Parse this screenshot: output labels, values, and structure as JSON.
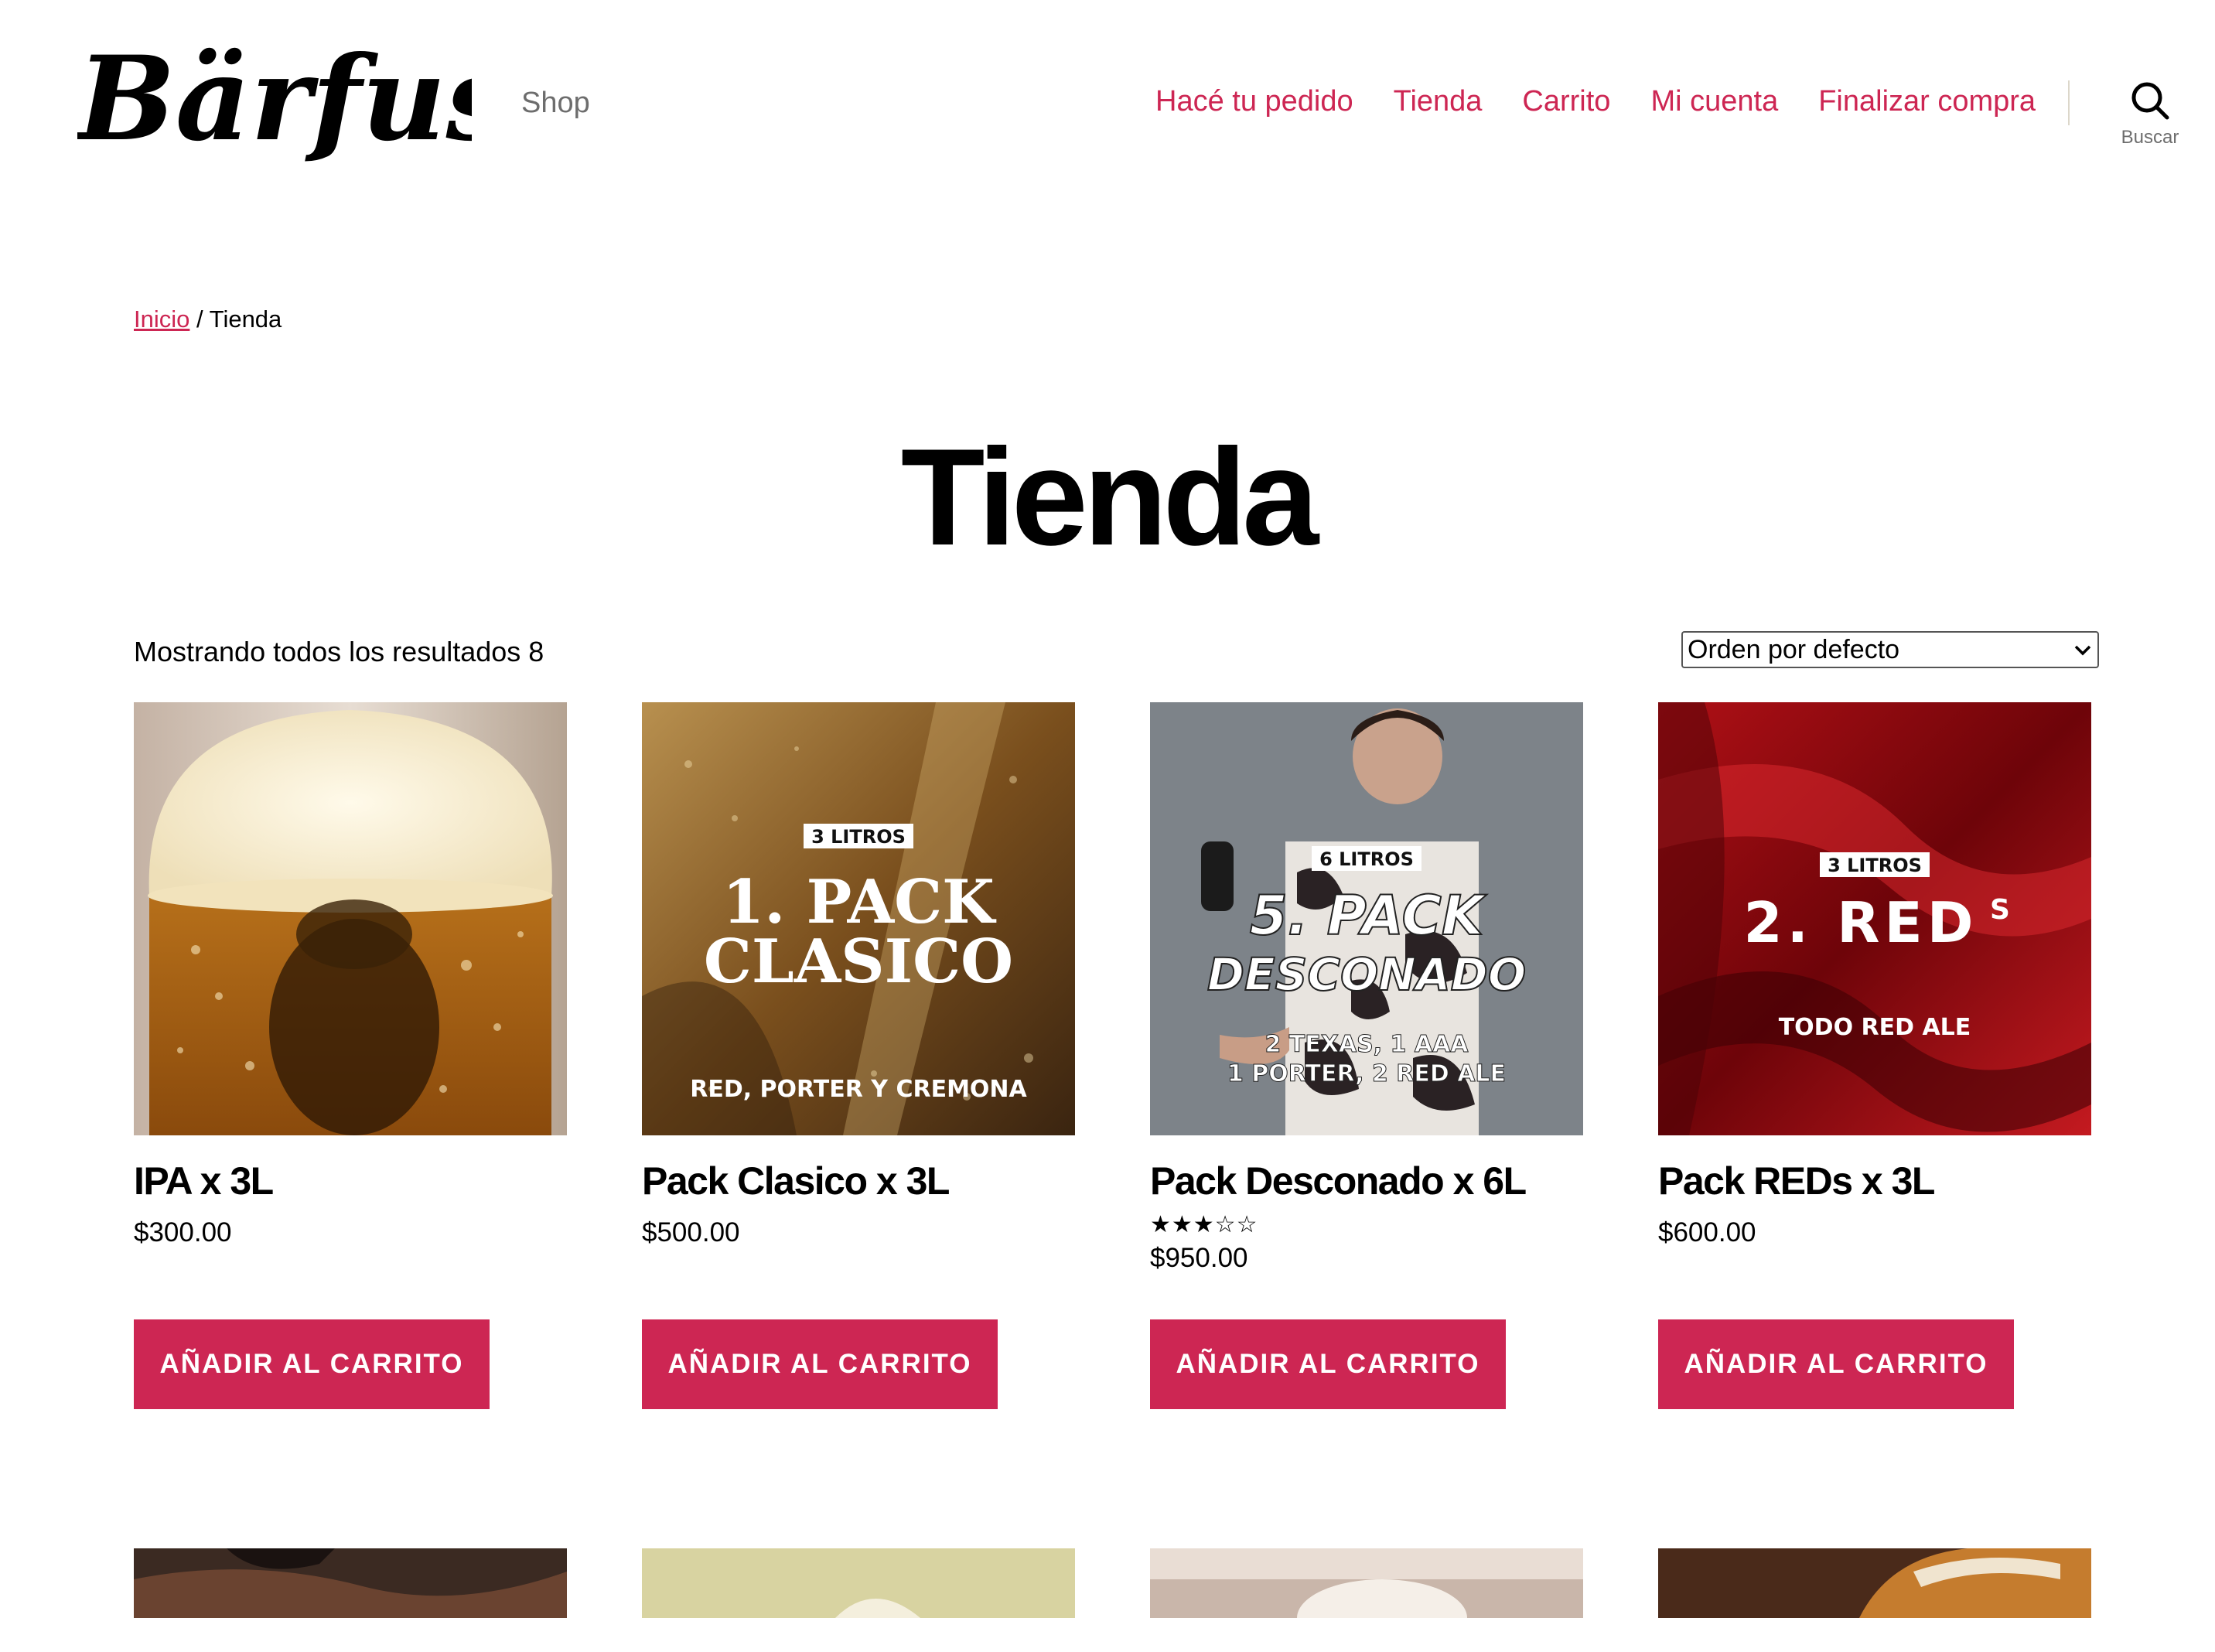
{
  "site": {
    "logo_text": "Bärfuss",
    "tagline": "Shop"
  },
  "nav": {
    "items": [
      {
        "label": "Hacé tu pedido"
      },
      {
        "label": "Tienda"
      },
      {
        "label": "Carrito"
      },
      {
        "label": "Mi cuenta"
      },
      {
        "label": "Finalizar compra"
      }
    ],
    "search_label": "Buscar"
  },
  "breadcrumb": {
    "home": "Inicio",
    "separator": " / ",
    "current": "Tienda"
  },
  "page": {
    "title": "Tienda",
    "result_count": "Mostrando todos los resultados 8",
    "ordering": "Orden por defecto"
  },
  "colors": {
    "accent": "#cd2653"
  },
  "products": [
    {
      "name": "IPA x 3L",
      "price": "$300.00",
      "button": "AÑADIR AL CARRITO"
    },
    {
      "name": "Pack Clasico x 3L",
      "price": "$500.00",
      "button": "AÑADIR AL CARRITO",
      "image_text": {
        "badge": "3 LITROS",
        "line1": "1. PACK",
        "line2": "CLASICO",
        "sub": "RED, PORTER Y CREMONA"
      }
    },
    {
      "name": "Pack Desconado x 6L",
      "price": "$950.00",
      "button": "AÑADIR AL CARRITO",
      "rating": 3,
      "rating_stars": "★★★☆☆",
      "image_text": {
        "badge": "6 LITROS",
        "line1": "5. PACK",
        "line2": "DESCONADO",
        "sub1": "2 TEXAS, 1 AAA",
        "sub2": "1 PORTER, 2 RED ALE"
      }
    },
    {
      "name": "Pack REDs x 3L",
      "price": "$600.00",
      "button": "AÑADIR AL CARRITO",
      "image_text": {
        "badge": "3 LITROS",
        "line1": "2. RED",
        "line1_sup": "S",
        "sub": "TODO RED ALE"
      }
    }
  ]
}
